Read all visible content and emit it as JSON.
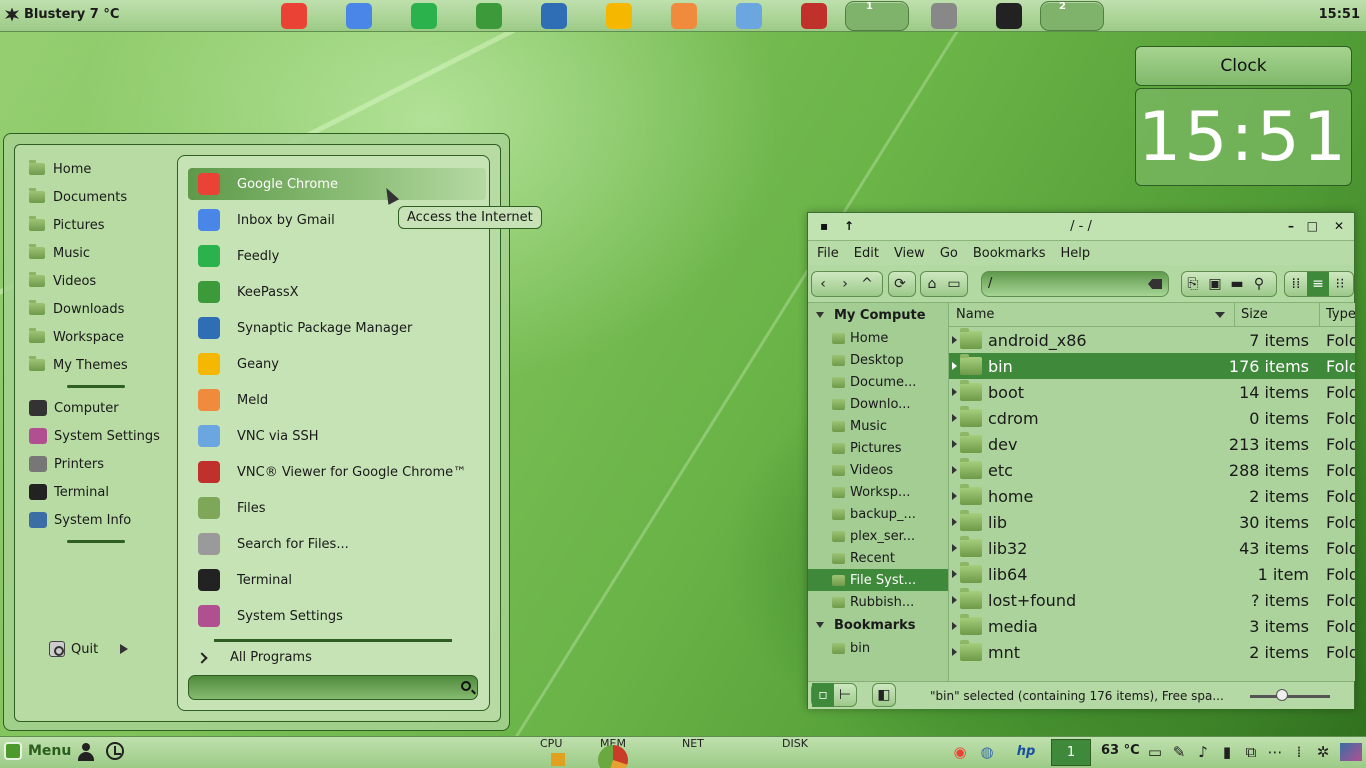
{
  "top_panel": {
    "weather": "Blustery 7 °C",
    "clock": "15:51",
    "launchers": [
      {
        "icon": "chrome-icon",
        "color": "#ea4335"
      },
      {
        "icon": "inbox-gmail-icon",
        "color": "#4a86e8"
      },
      {
        "icon": "feedly-icon",
        "color": "#2bb24c"
      },
      {
        "icon": "keepassx-icon",
        "color": "#3d9a3a"
      },
      {
        "icon": "synaptic-icon",
        "color": "#2f6db5"
      },
      {
        "icon": "geany-icon",
        "color": "#f5b700"
      },
      {
        "icon": "meld-icon",
        "color": "#f08a3c"
      },
      {
        "icon": "vnc-ssh-icon",
        "color": "#6ba6e0"
      },
      {
        "icon": "vnc-viewer-icon",
        "color": "#c0312b"
      },
      {
        "icon": "files-icon",
        "color": "#7ea75a"
      },
      {
        "icon": "search-files-icon",
        "color": "#888888"
      },
      {
        "icon": "terminal-icon",
        "color": "#222222"
      },
      {
        "icon": "settings-app-icon",
        "color": "#8a2e2e"
      }
    ],
    "workspace_badges": [
      "1",
      "2"
    ]
  },
  "clock_desklet": {
    "title": "Clock",
    "time": "15:51"
  },
  "menu": {
    "places": [
      {
        "label": "Home",
        "icon": "home-folder-icon"
      },
      {
        "label": "Documents",
        "icon": "documents-folder-icon"
      },
      {
        "label": "Pictures",
        "icon": "pictures-folder-icon"
      },
      {
        "label": "Music",
        "icon": "music-folder-icon"
      },
      {
        "label": "Videos",
        "icon": "videos-folder-icon"
      },
      {
        "label": "Downloads",
        "icon": "downloads-folder-icon"
      },
      {
        "label": "Workspace",
        "icon": "folder-icon"
      },
      {
        "label": "My Themes",
        "icon": "folder-icon"
      }
    ],
    "system": [
      {
        "label": "Computer",
        "icon": "computer-icon",
        "color": "#333333"
      },
      {
        "label": "System Settings",
        "icon": "system-settings-icon",
        "color": "#b05090"
      },
      {
        "label": "Printers",
        "icon": "printer-icon",
        "color": "#777777"
      },
      {
        "label": "Terminal",
        "icon": "terminal-icon",
        "color": "#222222"
      },
      {
        "label": "System Info",
        "icon": "system-info-icon",
        "color": "#3a6ea5"
      }
    ],
    "quit": "Quit",
    "apps": [
      {
        "label": "Google Chrome",
        "icon": "chrome-icon",
        "color": "#ea4335"
      },
      {
        "label": "Inbox by Gmail",
        "icon": "inbox-gmail-icon",
        "color": "#4a86e8"
      },
      {
        "label": "Feedly",
        "icon": "feedly-icon",
        "color": "#2bb24c"
      },
      {
        "label": "KeePassX",
        "icon": "keepassx-icon",
        "color": "#3d9a3a"
      },
      {
        "label": "Synaptic Package Manager",
        "icon": "synaptic-icon",
        "color": "#2f6db5"
      },
      {
        "label": "Geany",
        "icon": "geany-icon",
        "color": "#f5b700"
      },
      {
        "label": "Meld",
        "icon": "meld-icon",
        "color": "#f08a3c"
      },
      {
        "label": "VNC via SSH",
        "icon": "vnc-ssh-icon",
        "color": "#6ba6e0"
      },
      {
        "label": "VNC® Viewer for Google Chrome™",
        "icon": "vnc-viewer-icon",
        "color": "#c0312b"
      },
      {
        "label": "Files",
        "icon": "files-icon",
        "color": "#7ea75a"
      },
      {
        "label": "Search for Files...",
        "icon": "search-files-icon",
        "color": "#9a9a9a"
      },
      {
        "label": "Terminal",
        "icon": "terminal-icon",
        "color": "#222222"
      },
      {
        "label": "System Settings",
        "icon": "system-settings-icon",
        "color": "#b05090"
      }
    ],
    "all_programs": "All Programs",
    "search_placeholder": "",
    "tooltip": "Access the Internet"
  },
  "file_manager": {
    "title": "/ - /",
    "menubar": [
      "File",
      "Edit",
      "View",
      "Go",
      "Bookmarks",
      "Help"
    ],
    "location": "/",
    "sidebar_heading": "My Compute",
    "sidebar_items": [
      "Home",
      "Desktop",
      "Docume...",
      "Downlo...",
      "Music",
      "Pictures",
      "Videos",
      "Worksp...",
      "backup_...",
      "plex_ser...",
      "Recent",
      "File Syst...",
      "Rubbish..."
    ],
    "bookmarks_heading": "Bookmarks",
    "bookmarks": [
      "bin"
    ],
    "columns": {
      "name": "Name",
      "size": "Size",
      "type": "Type"
    },
    "rows": [
      {
        "name": "android_x86",
        "size": "7 items",
        "type": "Fold"
      },
      {
        "name": "bin",
        "size": "176 items",
        "type": "Fold"
      },
      {
        "name": "boot",
        "size": "14 items",
        "type": "Fold"
      },
      {
        "name": "cdrom",
        "size": "0 items",
        "type": "Fold"
      },
      {
        "name": "dev",
        "size": "213 items",
        "type": "Fold"
      },
      {
        "name": "etc",
        "size": "288 items",
        "type": "Fold"
      },
      {
        "name": "home",
        "size": "2 items",
        "type": "Fold"
      },
      {
        "name": "lib",
        "size": "30 items",
        "type": "Fold"
      },
      {
        "name": "lib32",
        "size": "43 items",
        "type": "Fold"
      },
      {
        "name": "lib64",
        "size": "1 item",
        "type": "Fold"
      },
      {
        "name": "lost+found",
        "size": "? items",
        "type": "Fold"
      },
      {
        "name": "media",
        "size": "3 items",
        "type": "Fold"
      },
      {
        "name": "mnt",
        "size": "2 items",
        "type": "Fold"
      }
    ],
    "selected_row": 1,
    "status": "\"bin\" selected (containing 176 items), Free spa...",
    "zoom_level": 0.4
  },
  "bottom_panel": {
    "menu_label": "Menu",
    "monitors": [
      "CPU",
      "MEM",
      "NET",
      "DISK"
    ],
    "workspace": "1",
    "temperature": "63 °C"
  }
}
